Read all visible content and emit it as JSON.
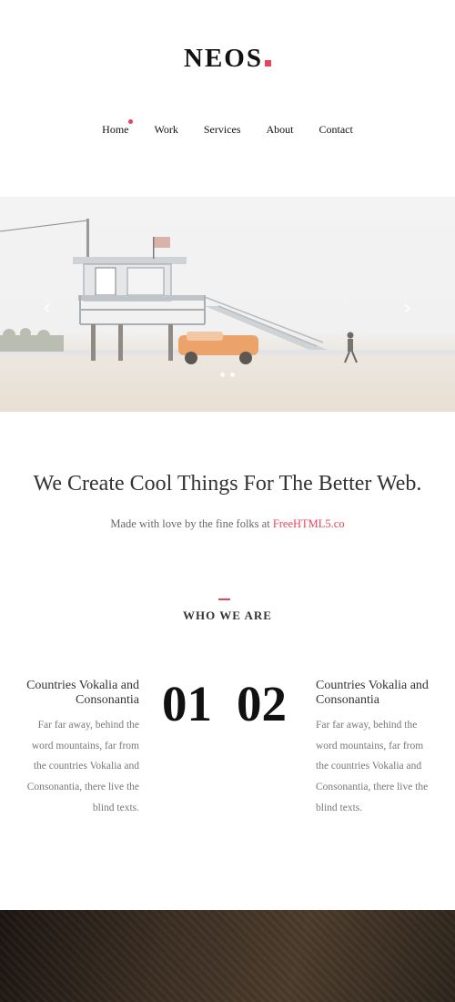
{
  "brand": {
    "name": "NEOS",
    "accent": "#e8445a"
  },
  "nav": [
    {
      "label": "Home",
      "active": true
    },
    {
      "label": "Work"
    },
    {
      "label": "Services"
    },
    {
      "label": "About"
    },
    {
      "label": "Contact"
    }
  ],
  "hero": {
    "prev_icon": "chevron-left-icon",
    "next_icon": "chevron-right-icon",
    "prev_glyph": "‹",
    "next_glyph": "›",
    "slide_count": 2
  },
  "intro": {
    "headline": "We Create Cool Things For The Better Web.",
    "byline": "Made with love by the fine folks at",
    "link": "FreeHTML5.co"
  },
  "who": {
    "title": "WHO WE ARE",
    "items": [
      {
        "number": "01",
        "heading": "Countries Vokalia and Consonantia",
        "text": "Far far away, behind the word mountains, far from the countries Vokalia and Consonantia, there live the blind texts."
      },
      {
        "number": "02",
        "heading": "Countries Vokalia and Consonantia",
        "text": "Far far away, behind the word mountains, far from the countries Vokalia and Consonantia, there live the blind texts."
      }
    ]
  }
}
